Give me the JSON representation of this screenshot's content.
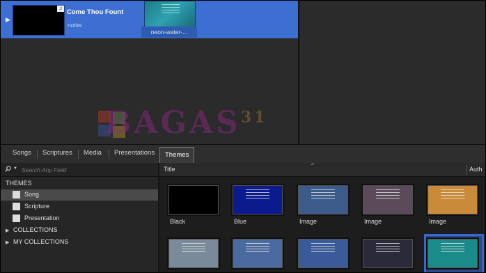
{
  "service": {
    "item_title": "Come Thou Fount",
    "item_notes": "notes",
    "theme_label": "neon-water-..."
  },
  "watermark": {
    "text": "BAGAS",
    "number": "31"
  },
  "tabs": [
    "Songs",
    "Scriptures",
    "Media",
    "Presentations",
    "Themes"
  ],
  "sidebar": {
    "search_placeholder": "Search Any Field",
    "section_header": "THEMES",
    "items": [
      "Song",
      "Scripture",
      "Presentation"
    ],
    "collections": "COLLECTIONS",
    "my_collections": "MY COLLECTIONS"
  },
  "grid": {
    "col_title": "Title",
    "col_author": "Auth",
    "themes": [
      {
        "label": "Black",
        "color": "#000000"
      },
      {
        "label": "Blue",
        "color": "#0b1a8c"
      },
      {
        "label": "Image",
        "color": "#3c5a8a"
      },
      {
        "label": "Image",
        "color": "#5a4a5a"
      },
      {
        "label": "Image",
        "color": "#c98a3a"
      },
      {
        "label": "",
        "color": "#7a8a9a"
      },
      {
        "label": "",
        "color": "#4a6aa0"
      },
      {
        "label": "",
        "color": "#3a5a9a"
      },
      {
        "label": "",
        "color": "#2a2a3a"
      },
      {
        "label": "",
        "color": "#1a8a8a"
      }
    ]
  }
}
